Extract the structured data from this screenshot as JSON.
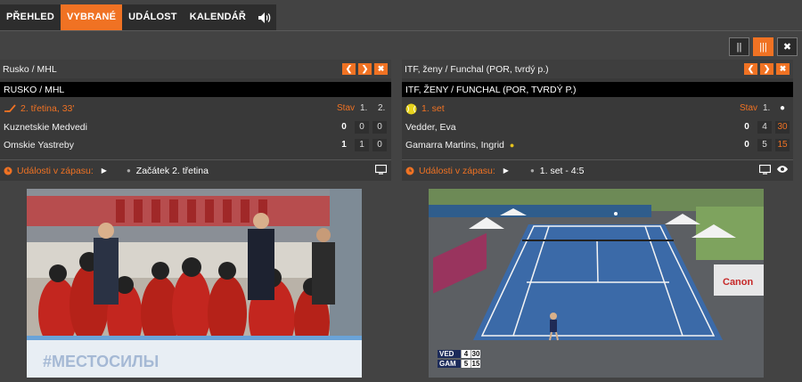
{
  "nav": {
    "tabs": [
      {
        "label": "PŘEHLED",
        "active": false
      },
      {
        "label": "VYBRANÉ",
        "active": true
      },
      {
        "label": "UDÁLOST",
        "active": false
      },
      {
        "label": "KALENDÁŘ",
        "active": false
      }
    ],
    "sound_icon": "speaker-icon"
  },
  "layout_buttons": [
    {
      "icon": "two-columns-icon",
      "glyph": "||",
      "active": false
    },
    {
      "icon": "three-columns-icon",
      "glyph": "|||",
      "active": true
    },
    {
      "icon": "close-icon",
      "glyph": "✖",
      "active": false
    }
  ],
  "colors": {
    "accent": "#f07223",
    "background": "#434343",
    "panel": "#393939"
  },
  "left_panel": {
    "title": "Rusko / MHL",
    "banner": "RUSKO / MHL",
    "period": "2. třetina, 33'",
    "sport_icon": "hockey-stick-icon",
    "col_total": "Stav",
    "col_1": "1.",
    "col_2": "2.",
    "teams": [
      {
        "name": "Kuznetskie Medvedi",
        "total": "0",
        "p1": "0",
        "p2": "0"
      },
      {
        "name": "Omskie Yastreby",
        "total": "1",
        "p1": "1",
        "p2": "0"
      }
    ],
    "events_label": "Události v zápasu:",
    "event_text": "Začátek 2. třetina"
  },
  "right_panel": {
    "title": "ITF, ženy / Funchal (POR, tvrdý p.)",
    "banner": "ITF, ŽENY / FUNCHAL (POR, TVRDÝ P.)",
    "period": "1. set",
    "sport_icon": "tennis-ball-icon",
    "col_total": "Stav",
    "col_1": "1.",
    "players": [
      {
        "name": "Vedder, Eva",
        "total": "0",
        "s1": "4",
        "game": "30",
        "serving": false
      },
      {
        "name": "Gamarra Martins, Ingrid",
        "total": "0",
        "s1": "5",
        "game": "15",
        "serving": true
      }
    ],
    "events_label": "Události v zápasu:",
    "event_text": "1. set - 4:5"
  },
  "hockey_video": {
    "description_icon": "hockey-stream-icon"
  },
  "tennis_video": {
    "scorebug": [
      {
        "code": "VED",
        "games": "4",
        "points": "30"
      },
      {
        "code": "GAM",
        "games": "5",
        "points": "15"
      }
    ]
  }
}
